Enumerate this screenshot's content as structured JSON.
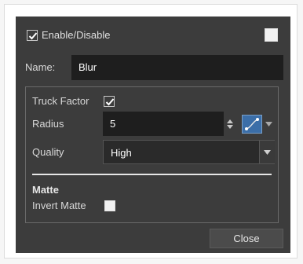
{
  "header": {
    "enable_label": "Enable/Disable",
    "enable_checked": true,
    "swatch_color": "#f2f2f2"
  },
  "name_row": {
    "label": "Name:",
    "value": "Blur"
  },
  "params": {
    "truck_factor_label": "Truck Factor",
    "truck_factor_checked": true,
    "radius_label": "Radius",
    "radius_value": "5",
    "quality_label": "Quality",
    "quality_value": "High",
    "matte_heading": "Matte",
    "invert_matte_label": "Invert Matte",
    "invert_matte_checked": false
  },
  "footer": {
    "close_label": "Close"
  },
  "icons": [
    "checkmark-icon",
    "spin-arrows-icon",
    "function-curve-icon",
    "dropdown-arrow-icon"
  ],
  "colors": {
    "panel": "#3c3c3c",
    "field": "#1e1e1e",
    "curve_button": "#3b6ea8"
  }
}
